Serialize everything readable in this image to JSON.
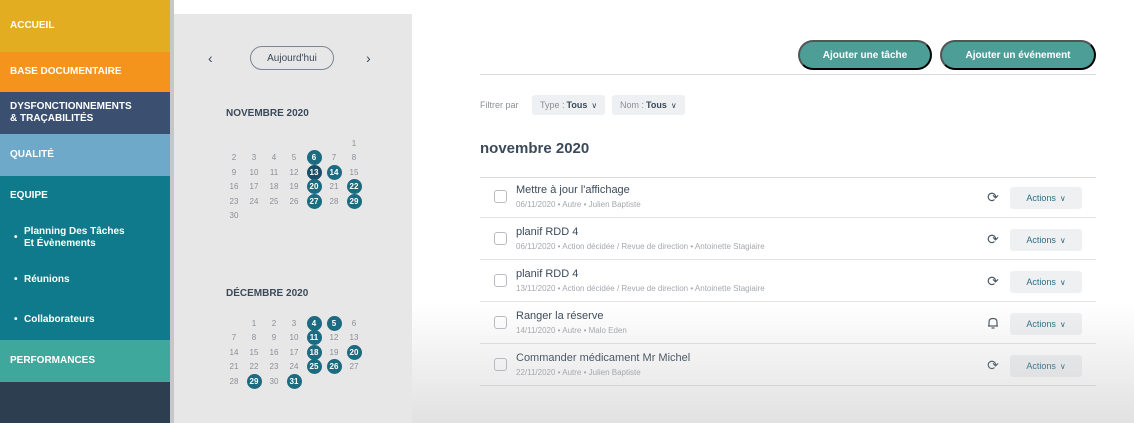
{
  "sidebar": {
    "items": [
      {
        "label": "ACCUEIL",
        "color": "#e3ad21"
      },
      {
        "label": "BASE DOCUMENTAIRE",
        "color": "#f5941d"
      },
      {
        "label": "DYSFONCTIONNEMENTS & TRAÇABILITÉS",
        "color": "#3b5071"
      },
      {
        "label": "QUALITÉ",
        "color": "#6ea9c9"
      },
      {
        "label": "EQUIPE",
        "color": "#0f7a8b"
      },
      {
        "label": "Planning Des Tâches Et Évènements",
        "color": "#0f7a8b"
      },
      {
        "label": "Réunions",
        "color": "#0f7a8b"
      },
      {
        "label": "Collaborateurs",
        "color": "#0f7a8b"
      },
      {
        "label": "PERFORMANCES",
        "color": "#3fa89c"
      }
    ]
  },
  "calendar": {
    "prev": "‹",
    "next": "›",
    "today_label": "Aujourd'hui",
    "months": [
      {
        "title": "NOVEMBRE 2020",
        "days": [
          {
            "d": ""
          },
          {
            "d": ""
          },
          {
            "d": ""
          },
          {
            "d": ""
          },
          {
            "d": ""
          },
          {
            "d": ""
          },
          {
            "d": "1"
          },
          {
            "d": "2"
          },
          {
            "d": "3"
          },
          {
            "d": "4"
          },
          {
            "d": "5"
          },
          {
            "d": "6",
            "hl": true
          },
          {
            "d": "7"
          },
          {
            "d": "8"
          },
          {
            "d": "9"
          },
          {
            "d": "10"
          },
          {
            "d": "11"
          },
          {
            "d": "12"
          },
          {
            "d": "13",
            "hl": true,
            "dark": true
          },
          {
            "d": "14",
            "hl": true
          },
          {
            "d": "15"
          },
          {
            "d": "16"
          },
          {
            "d": "17"
          },
          {
            "d": "18"
          },
          {
            "d": "19"
          },
          {
            "d": "20",
            "hl": true
          },
          {
            "d": "21"
          },
          {
            "d": "22",
            "hl": true
          },
          {
            "d": "23"
          },
          {
            "d": "24"
          },
          {
            "d": "25"
          },
          {
            "d": "26"
          },
          {
            "d": "27",
            "hl": true
          },
          {
            "d": "28"
          },
          {
            "d": "29",
            "hl": true
          },
          {
            "d": "30"
          }
        ]
      },
      {
        "title": "DÉCEMBRE 2020",
        "days": [
          {
            "d": ""
          },
          {
            "d": "1"
          },
          {
            "d": "2"
          },
          {
            "d": "3"
          },
          {
            "d": "4",
            "hl": true
          },
          {
            "d": "5",
            "hl": true
          },
          {
            "d": "6"
          },
          {
            "d": "7"
          },
          {
            "d": "8"
          },
          {
            "d": "9"
          },
          {
            "d": "10"
          },
          {
            "d": "11",
            "hl": true
          },
          {
            "d": "12"
          },
          {
            "d": "13"
          },
          {
            "d": "14"
          },
          {
            "d": "15"
          },
          {
            "d": "16"
          },
          {
            "d": "17"
          },
          {
            "d": "18",
            "hl": true
          },
          {
            "d": "19"
          },
          {
            "d": "20",
            "hl": true
          },
          {
            "d": "21"
          },
          {
            "d": "22"
          },
          {
            "d": "23"
          },
          {
            "d": "24"
          },
          {
            "d": "25",
            "hl": true
          },
          {
            "d": "26",
            "hl": true
          },
          {
            "d": "27"
          },
          {
            "d": "28"
          },
          {
            "d": "29",
            "hl": true
          },
          {
            "d": "30"
          },
          {
            "d": "31",
            "hl": true
          }
        ]
      }
    ]
  },
  "main": {
    "add_task_label": "Ajouter une tâche",
    "add_event_label": "Ajouter un événement",
    "filter_label": "Filtrer par",
    "filter_type_label": "Type :",
    "filter_type_value": "Tous",
    "filter_name_label": "Nom :",
    "filter_name_value": "Tous",
    "month_heading": "novembre 2020",
    "tasks": [
      {
        "title": "Mettre à jour l'affichage",
        "meta": "06/11/2020 • Autre • Julien Baptiste",
        "icon": "refresh-icon",
        "action": "Actions"
      },
      {
        "title": "planif RDD 4",
        "meta": "06/11/2020 • Action décidée / Revue de direction • Antoinette Stagiaire",
        "icon": "refresh-icon",
        "action": "Actions"
      },
      {
        "title": "planif RDD 4",
        "meta": "13/11/2020 • Action décidée / Revue de direction • Antoinette Stagiaire",
        "icon": "refresh-icon",
        "action": "Actions"
      },
      {
        "title": "Ranger la réserve",
        "meta": "14/11/2020 • Autre • Malo Eden",
        "icon": "bell-icon",
        "action": "Actions"
      },
      {
        "title": "Commander médicament Mr Michel",
        "meta": "22/11/2020 • Autre • Julien Baptiste",
        "icon": "refresh-icon",
        "action": "Actions"
      }
    ]
  }
}
